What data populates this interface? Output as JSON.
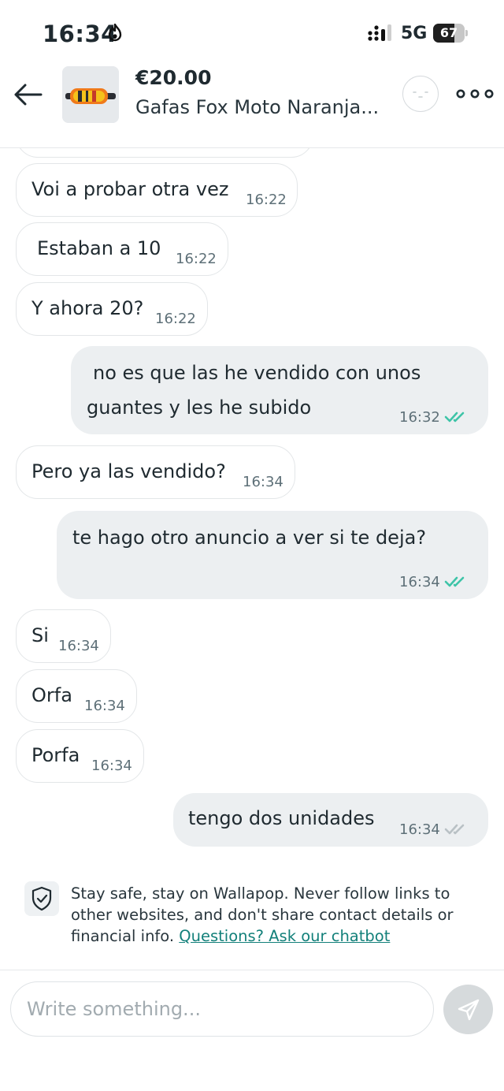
{
  "status_bar": {
    "time": "16:34",
    "network": "5G",
    "battery": "67",
    "battery_level": 0.67
  },
  "header": {
    "price": "€20.00",
    "title": "Gafas Fox Moto Naranja..."
  },
  "messages": [
    {
      "direction": "in",
      "text": "Voi a probar otra vez",
      "time": "16:22"
    },
    {
      "direction": "in",
      "text": "Estaban a 10",
      "time": "16:22"
    },
    {
      "direction": "in",
      "text": "Y ahora 20?",
      "time": "16:22"
    },
    {
      "direction": "out",
      "line1": "no es que las he vendido con unos",
      "line2": "guantes y les he subido",
      "time": "16:32",
      "status": "read"
    },
    {
      "direction": "in",
      "text": "Pero ya las vendido?",
      "time": "16:34"
    },
    {
      "direction": "out",
      "text": "te hago otro anuncio a ver si te deja?",
      "time": "16:34",
      "status": "read"
    },
    {
      "direction": "in",
      "text": "Si",
      "time": "16:34"
    },
    {
      "direction": "in",
      "text": "Orfa",
      "time": "16:34"
    },
    {
      "direction": "in",
      "text": "Porfa",
      "time": "16:34"
    },
    {
      "direction": "out",
      "text": "tengo dos unidades",
      "time": "16:34",
      "status": "delivered"
    }
  ],
  "notice": {
    "text": "Stay safe, stay on Wallapop. Never follow links to other websites, and don't share contact details or financial info.",
    "link": "Questions? Ask our chatbot"
  },
  "composer": {
    "placeholder": "Write something..."
  },
  "colors": {
    "read_check": "#3ec4a8",
    "delivered_check": "#b9c1c5",
    "link": "#13807a",
    "outgoing_bubble": "#eceff1"
  }
}
